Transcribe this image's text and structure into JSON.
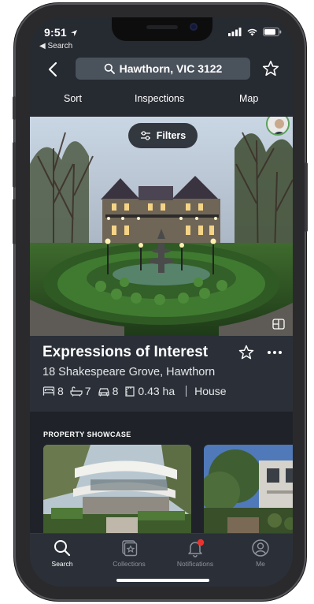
{
  "status": {
    "time": "9:51",
    "back_app": "◀ Search"
  },
  "search": {
    "query": "Hawthorn, VIC 3122"
  },
  "tabs": {
    "sort": "Sort",
    "inspections": "Inspections",
    "map": "Map"
  },
  "hero": {
    "filters_label": "Filters"
  },
  "listing": {
    "title": "Expressions of Interest",
    "address": "18 Shakespeare Grove, Hawthorn",
    "beds": "8",
    "baths": "7",
    "cars": "8",
    "land": "0.43 ha",
    "type": "House"
  },
  "showcase": {
    "title": "PROPERTY SHOWCASE"
  },
  "tabbar": {
    "search": "Search",
    "collections": "Collections",
    "notifications": "Notifications",
    "me": "Me"
  },
  "colors": {
    "screen_bg": "#262a31",
    "panel_bg": "#2b3038",
    "notification_dot": "#e8332f",
    "inactive_tab": "#8d939b"
  }
}
